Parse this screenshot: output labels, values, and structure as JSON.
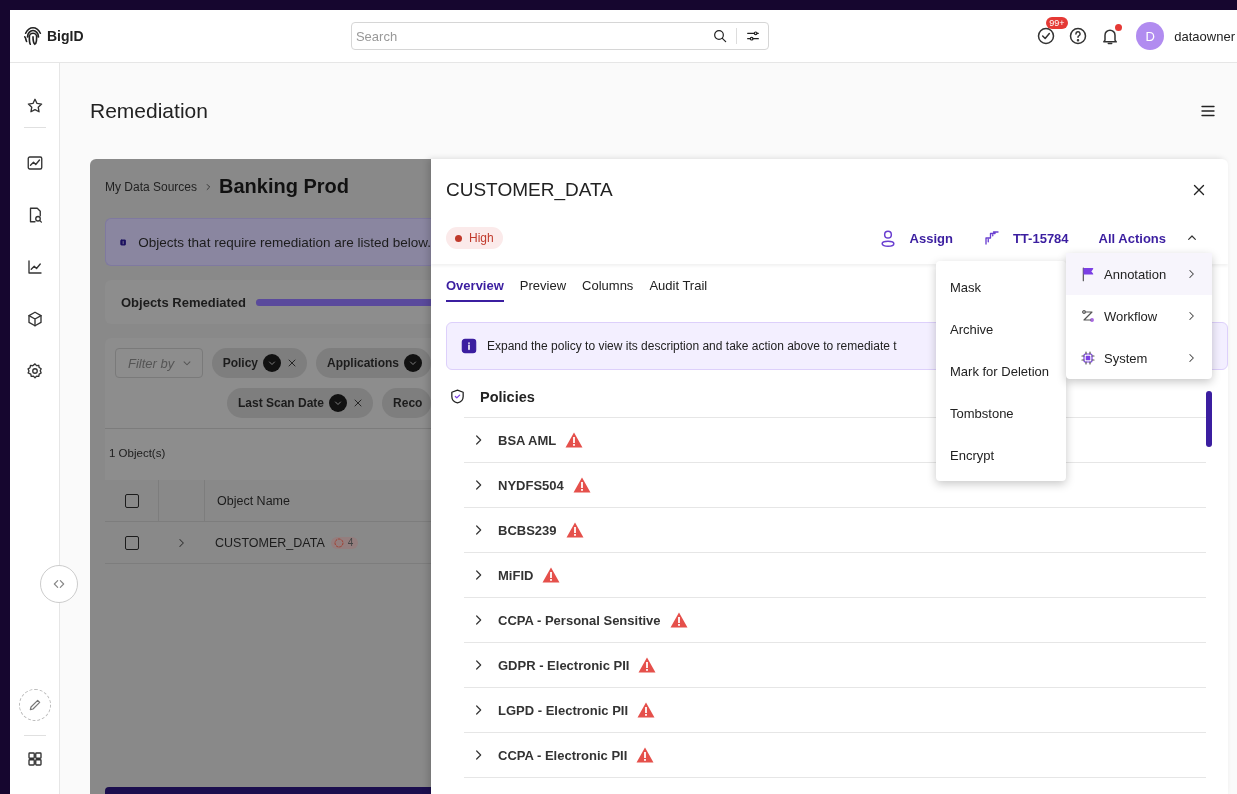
{
  "topbar": {
    "logo": "BigID",
    "search": {
      "placeholder": "Search"
    },
    "tasks_badge": "99+",
    "notifications_unread": true,
    "avatar": "D",
    "user": "dataowner"
  },
  "page": {
    "title": "Remediation"
  },
  "background_page": {
    "breadcrumb": "My Data Sources",
    "title": "Banking Prod",
    "info": "Objects that require remediation are listed below.",
    "progress_label": "Objects Remediated",
    "progress": {
      "level": 1
    },
    "filter": {
      "placeholder": "Filter by"
    },
    "chips": [
      {
        "label": "Policy",
        "removable": true
      },
      {
        "label": "Applications",
        "removable": false
      },
      {
        "label": "Last Scan Date",
        "removable": true
      },
      {
        "label": "Reco",
        "removable": false
      }
    ],
    "count": "1 Object(s)",
    "table": {
      "columns": [
        "Object Name"
      ],
      "all_selected": false,
      "rows": [
        {
          "checked": false,
          "name": "CUSTOMER_DATA",
          "badge": "4"
        }
      ]
    }
  },
  "drawer": {
    "title": "CUSTOMER_DATA",
    "severity": {
      "label": "High",
      "color": "#c0392b"
    },
    "actions": [
      {
        "kind": "assign",
        "label": "Assign"
      },
      {
        "kind": "ticket",
        "label": "TT-15784"
      },
      {
        "kind": "menu",
        "label": "All Actions",
        "expanded": true
      }
    ],
    "tabs": [
      {
        "label": "Overview",
        "selected": true
      },
      {
        "label": "Preview",
        "selected": false
      },
      {
        "label": "Columns",
        "selected": false
      },
      {
        "label": "Audit Trail",
        "selected": false
      }
    ],
    "info": "Expand the policy to view its description and take action above to remediate t",
    "section": "Policies",
    "policies": [
      {
        "name": "BSA AML",
        "warning": true
      },
      {
        "name": "NYDFS504",
        "warning": true
      },
      {
        "name": "BCBS239",
        "warning": true
      },
      {
        "name": "MiFID",
        "warning": true
      },
      {
        "name": "CCPA - Personal Sensitive",
        "warning": true
      },
      {
        "name": "GDPR - Electronic PII",
        "warning": true
      },
      {
        "name": "LGPD - Electronic PII",
        "warning": true
      },
      {
        "name": "CCPA - Electronic PII",
        "warning": true
      }
    ]
  },
  "actions_menu": {
    "items": [
      {
        "kind": "annotation",
        "label": "Annotation",
        "selected": true
      },
      {
        "kind": "workflow",
        "label": "Workflow",
        "selected": false
      },
      {
        "kind": "system",
        "label": "System",
        "selected": false
      }
    ],
    "submenu": [
      "Mask",
      "Archive",
      "Mark for Deletion",
      "Tombstone",
      "Encrypt"
    ]
  }
}
